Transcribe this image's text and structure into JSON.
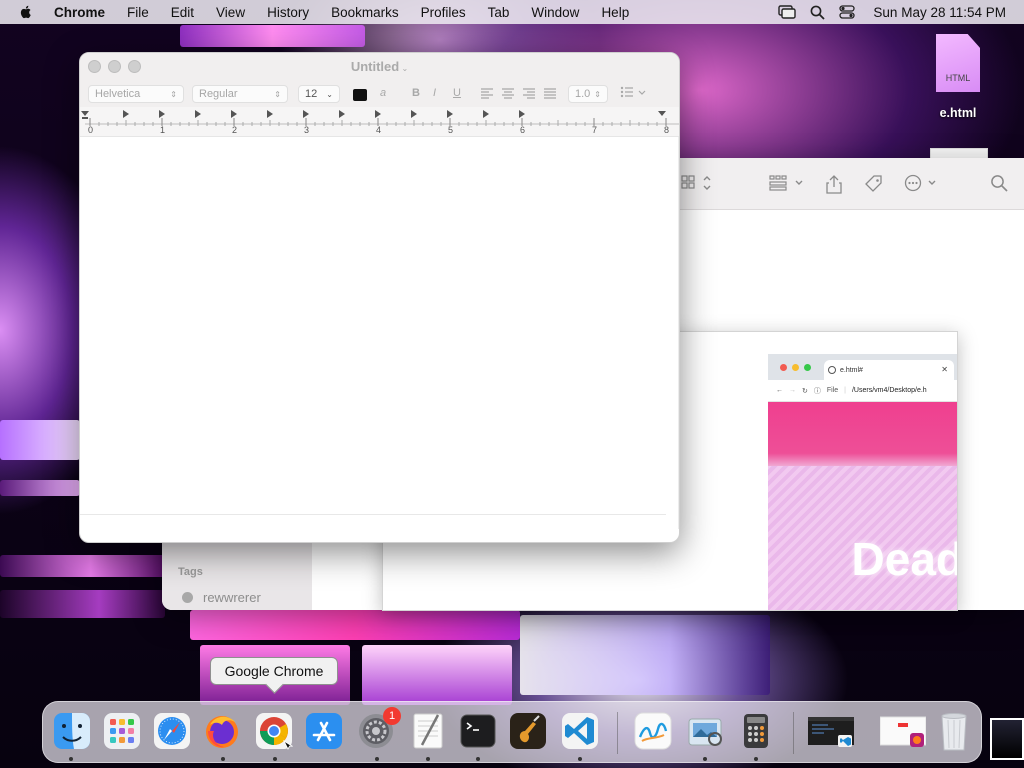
{
  "menubar": {
    "app_name": "Chrome",
    "items": [
      "File",
      "Edit",
      "View",
      "History",
      "Bookmarks",
      "Profiles",
      "Tab",
      "Window",
      "Help"
    ],
    "clock": "Sun May 28  11:54 PM"
  },
  "desktop": {
    "file_icon_type": "HTML",
    "file_name": "e.html"
  },
  "textedit": {
    "title": "Untitled",
    "font_family": "Helvetica",
    "font_style": "Regular",
    "font_size": "12",
    "line_spacing": "1.0",
    "ruler_numbers": [
      "0",
      "1",
      "2",
      "3",
      "4",
      "5",
      "6",
      "7",
      "8"
    ]
  },
  "finder": {
    "tags_header": "Tags",
    "tags": [
      {
        "name": "rewwrerer",
        "color": "#a8a8a8"
      }
    ]
  },
  "quicklook_chrome": {
    "tab_title": "e.html#",
    "address_label": "File",
    "address_url": "/Users/vm4/Desktop/e.h",
    "hero_text": "Dead",
    "banner_color": "#ef3f8f"
  },
  "dock": {
    "tooltip": "Google Chrome",
    "apps": [
      {
        "name": "finder-icon",
        "running": true
      },
      {
        "name": "launchpad-icon",
        "running": false
      },
      {
        "name": "safari-icon",
        "running": false
      },
      {
        "name": "firefox-icon",
        "running": true
      },
      {
        "name": "chrome-icon",
        "running": true
      },
      {
        "name": "app-store-icon",
        "running": false
      },
      {
        "name": "system-settings-icon",
        "running": true,
        "badge": "1"
      },
      {
        "name": "textedit-icon",
        "running": true
      },
      {
        "name": "terminal-icon",
        "running": true
      },
      {
        "name": "garageband-icon",
        "running": false
      },
      {
        "name": "vscode-icon",
        "running": true
      },
      {
        "name": "freeform-icon",
        "running": false
      },
      {
        "name": "preview-icon",
        "running": true
      },
      {
        "name": "calculator-icon",
        "running": true
      }
    ]
  }
}
